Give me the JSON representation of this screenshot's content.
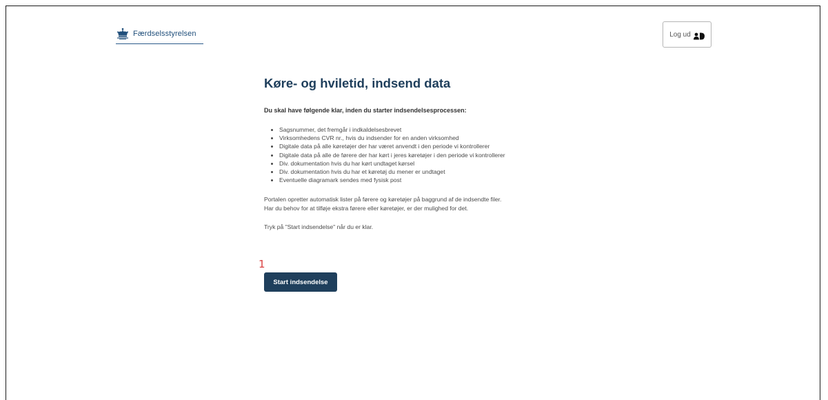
{
  "header": {
    "logo_text": "Færdselsstyrelsen",
    "logout_label": "Log ud"
  },
  "main": {
    "title": "Køre- og hviletid, indsend data",
    "intro": "Du skal have følgende klar, inden du starter indsendelsesprocessen:",
    "requirements": [
      "Sagsnummer, det fremgår i indkaldelsesbrevet",
      "Virksomhedens CVR nr., hvis du indsender for en anden virksomhed",
      "Digitale data på alle køretøjer der har været anvendt i den periode vi kontrollerer",
      "Digitale data på alle de førere der har kørt i jeres køretøjer i den periode vi kontrollerer",
      "Div. dokumentation hvis du har kørt undtaget kørsel",
      "Div. dokumentation hvis du har et køretøj du mener er undtaget",
      "Eventuelle diagramark sendes med fysisk post"
    ],
    "paragraph_line1": "Portalen opretter automatisk lister på førere og køretøjer på baggrund af de indsendte filer.",
    "paragraph_line2": "Har du behov for at tilføje ekstra førere eller køretøjer, er der mulighed for det.",
    "instruction": "Tryk på \"Start indsendelse\" når du er klar.",
    "start_button_label": "Start indsendelse"
  },
  "annotation": {
    "marker": "1"
  },
  "colors": {
    "primary": "#1f3f5c",
    "annotation": "#d94040",
    "logo": "#1f4e7a"
  },
  "icons": {
    "logo": "crown-icon",
    "logout": "user-id-icon"
  }
}
